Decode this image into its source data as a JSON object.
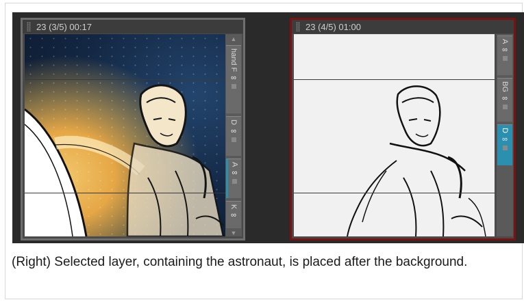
{
  "panels": {
    "left": {
      "header": "23 (3/5) 00:17",
      "layers": [
        {
          "label": "hand F"
        },
        {
          "label": "D"
        },
        {
          "label": "A"
        },
        {
          "label": "K"
        }
      ]
    },
    "right": {
      "header": "23 (4/5) 01:00",
      "layers": [
        {
          "label": "A"
        },
        {
          "label": "BG"
        },
        {
          "label": "D"
        }
      ]
    }
  },
  "caption": "(Right) Selected layer, containing the astronaut, is placed after the background.",
  "colors": {
    "selected_panel_border": "#7a1212",
    "selected_layer": "#2b8fb0"
  },
  "icons": {
    "visibility": "eye-icon",
    "lock": "lock-icon",
    "grip": "drag-handle-icon"
  }
}
